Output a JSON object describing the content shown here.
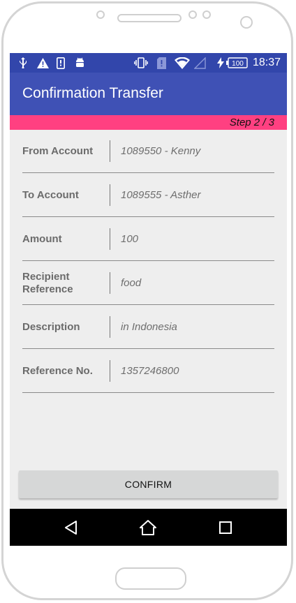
{
  "status_bar": {
    "time": "18:37",
    "battery": "100",
    "icons": [
      "usb-icon",
      "warning-icon",
      "phone-alert-icon",
      "android-debug-icon",
      "vibrate-icon",
      "sim-alert-icon",
      "wifi-icon",
      "signal-icon",
      "charging-icon",
      "battery-icon"
    ]
  },
  "app_bar": {
    "title": "Confirmation Transfer"
  },
  "step": {
    "text": "Step 2 / 3"
  },
  "details": [
    {
      "label": "From Account",
      "value": "1089550 - Kenny"
    },
    {
      "label": "To Account",
      "value": "1089555 - Asther"
    },
    {
      "label": "Amount",
      "value": "100"
    },
    {
      "label": "Recipient Reference",
      "value": "food"
    },
    {
      "label": "Description",
      "value": "in Indonesia"
    },
    {
      "label": "Reference No.",
      "value": "1357246800"
    }
  ],
  "actions": {
    "confirm_label": "CONFIRM"
  },
  "nav_bar": {
    "icons": [
      "back-icon",
      "home-icon",
      "recents-icon"
    ]
  },
  "colors": {
    "primary": "#3f51b5",
    "primary_dark": "#3246ab",
    "accent": "#ff4081",
    "background": "#eeeeee"
  }
}
